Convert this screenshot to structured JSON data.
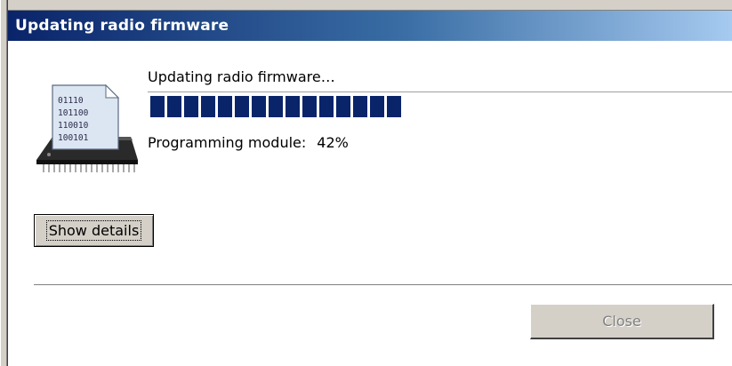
{
  "window": {
    "title": "Updating radio firmware"
  },
  "icon": {
    "name": "chip-firmware-icon",
    "binary_lines": [
      "01110",
      "101100",
      "110010",
      "100101"
    ]
  },
  "status": {
    "heading": "Updating radio firmware…",
    "progress_percent": 42,
    "progress_bar_fill_fraction": 0.43,
    "module_label": "Programming module:",
    "module_percent": "42%"
  },
  "buttons": {
    "show_details": "Show details",
    "close": "Close"
  },
  "colors": {
    "titlebar_start": "#0a246a",
    "titlebar_end": "#a6caf0",
    "progress_block": "#0a246a",
    "face": "#d4d0c8"
  }
}
